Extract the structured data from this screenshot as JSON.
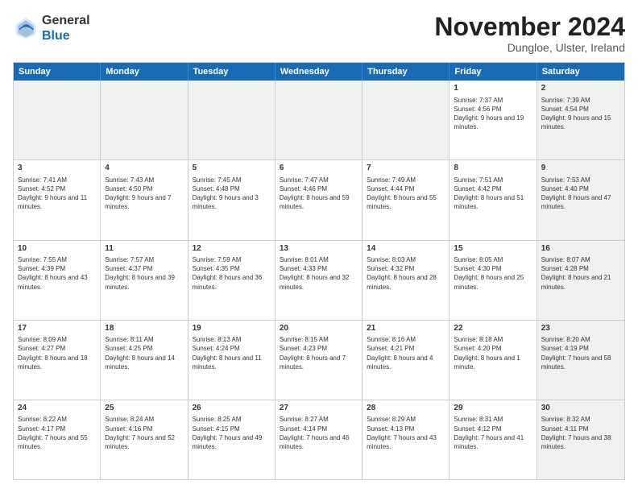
{
  "logo": {
    "general": "General",
    "blue": "Blue"
  },
  "header": {
    "title": "November 2024",
    "subtitle": "Dungloe, Ulster, Ireland"
  },
  "days_of_week": [
    "Sunday",
    "Monday",
    "Tuesday",
    "Wednesday",
    "Thursday",
    "Friday",
    "Saturday"
  ],
  "weeks": [
    [
      {
        "day": "",
        "info": "",
        "shaded": true
      },
      {
        "day": "",
        "info": "",
        "shaded": true
      },
      {
        "day": "",
        "info": "",
        "shaded": true
      },
      {
        "day": "",
        "info": "",
        "shaded": true
      },
      {
        "day": "",
        "info": "",
        "shaded": true
      },
      {
        "day": "1",
        "info": "Sunrise: 7:37 AM\nSunset: 4:56 PM\nDaylight: 9 hours and 19 minutes.",
        "shaded": false
      },
      {
        "day": "2",
        "info": "Sunrise: 7:39 AM\nSunset: 4:54 PM\nDaylight: 9 hours and 15 minutes.",
        "shaded": true
      }
    ],
    [
      {
        "day": "3",
        "info": "Sunrise: 7:41 AM\nSunset: 4:52 PM\nDaylight: 9 hours and 11 minutes.",
        "shaded": false
      },
      {
        "day": "4",
        "info": "Sunrise: 7:43 AM\nSunset: 4:50 PM\nDaylight: 9 hours and 7 minutes.",
        "shaded": false
      },
      {
        "day": "5",
        "info": "Sunrise: 7:45 AM\nSunset: 4:48 PM\nDaylight: 9 hours and 3 minutes.",
        "shaded": false
      },
      {
        "day": "6",
        "info": "Sunrise: 7:47 AM\nSunset: 4:46 PM\nDaylight: 8 hours and 59 minutes.",
        "shaded": false
      },
      {
        "day": "7",
        "info": "Sunrise: 7:49 AM\nSunset: 4:44 PM\nDaylight: 8 hours and 55 minutes.",
        "shaded": false
      },
      {
        "day": "8",
        "info": "Sunrise: 7:51 AM\nSunset: 4:42 PM\nDaylight: 8 hours and 51 minutes.",
        "shaded": false
      },
      {
        "day": "9",
        "info": "Sunrise: 7:53 AM\nSunset: 4:40 PM\nDaylight: 8 hours and 47 minutes.",
        "shaded": true
      }
    ],
    [
      {
        "day": "10",
        "info": "Sunrise: 7:55 AM\nSunset: 4:39 PM\nDaylight: 8 hours and 43 minutes.",
        "shaded": false
      },
      {
        "day": "11",
        "info": "Sunrise: 7:57 AM\nSunset: 4:37 PM\nDaylight: 8 hours and 39 minutes.",
        "shaded": false
      },
      {
        "day": "12",
        "info": "Sunrise: 7:59 AM\nSunset: 4:35 PM\nDaylight: 8 hours and 36 minutes.",
        "shaded": false
      },
      {
        "day": "13",
        "info": "Sunrise: 8:01 AM\nSunset: 4:33 PM\nDaylight: 8 hours and 32 minutes.",
        "shaded": false
      },
      {
        "day": "14",
        "info": "Sunrise: 8:03 AM\nSunset: 4:32 PM\nDaylight: 8 hours and 28 minutes.",
        "shaded": false
      },
      {
        "day": "15",
        "info": "Sunrise: 8:05 AM\nSunset: 4:30 PM\nDaylight: 8 hours and 25 minutes.",
        "shaded": false
      },
      {
        "day": "16",
        "info": "Sunrise: 8:07 AM\nSunset: 4:28 PM\nDaylight: 8 hours and 21 minutes.",
        "shaded": true
      }
    ],
    [
      {
        "day": "17",
        "info": "Sunrise: 8:09 AM\nSunset: 4:27 PM\nDaylight: 8 hours and 18 minutes.",
        "shaded": false
      },
      {
        "day": "18",
        "info": "Sunrise: 8:11 AM\nSunset: 4:25 PM\nDaylight: 8 hours and 14 minutes.",
        "shaded": false
      },
      {
        "day": "19",
        "info": "Sunrise: 8:13 AM\nSunset: 4:24 PM\nDaylight: 8 hours and 11 minutes.",
        "shaded": false
      },
      {
        "day": "20",
        "info": "Sunrise: 8:15 AM\nSunset: 4:23 PM\nDaylight: 8 hours and 7 minutes.",
        "shaded": false
      },
      {
        "day": "21",
        "info": "Sunrise: 8:16 AM\nSunset: 4:21 PM\nDaylight: 8 hours and 4 minutes.",
        "shaded": false
      },
      {
        "day": "22",
        "info": "Sunrise: 8:18 AM\nSunset: 4:20 PM\nDaylight: 8 hours and 1 minute.",
        "shaded": false
      },
      {
        "day": "23",
        "info": "Sunrise: 8:20 AM\nSunset: 4:19 PM\nDaylight: 7 hours and 58 minutes.",
        "shaded": true
      }
    ],
    [
      {
        "day": "24",
        "info": "Sunrise: 8:22 AM\nSunset: 4:17 PM\nDaylight: 7 hours and 55 minutes.",
        "shaded": false
      },
      {
        "day": "25",
        "info": "Sunrise: 8:24 AM\nSunset: 4:16 PM\nDaylight: 7 hours and 52 minutes.",
        "shaded": false
      },
      {
        "day": "26",
        "info": "Sunrise: 8:25 AM\nSunset: 4:15 PM\nDaylight: 7 hours and 49 minutes.",
        "shaded": false
      },
      {
        "day": "27",
        "info": "Sunrise: 8:27 AM\nSunset: 4:14 PM\nDaylight: 7 hours and 46 minutes.",
        "shaded": false
      },
      {
        "day": "28",
        "info": "Sunrise: 8:29 AM\nSunset: 4:13 PM\nDaylight: 7 hours and 43 minutes.",
        "shaded": false
      },
      {
        "day": "29",
        "info": "Sunrise: 8:31 AM\nSunset: 4:12 PM\nDaylight: 7 hours and 41 minutes.",
        "shaded": false
      },
      {
        "day": "30",
        "info": "Sunrise: 8:32 AM\nSunset: 4:11 PM\nDaylight: 7 hours and 38 minutes.",
        "shaded": true
      }
    ]
  ]
}
